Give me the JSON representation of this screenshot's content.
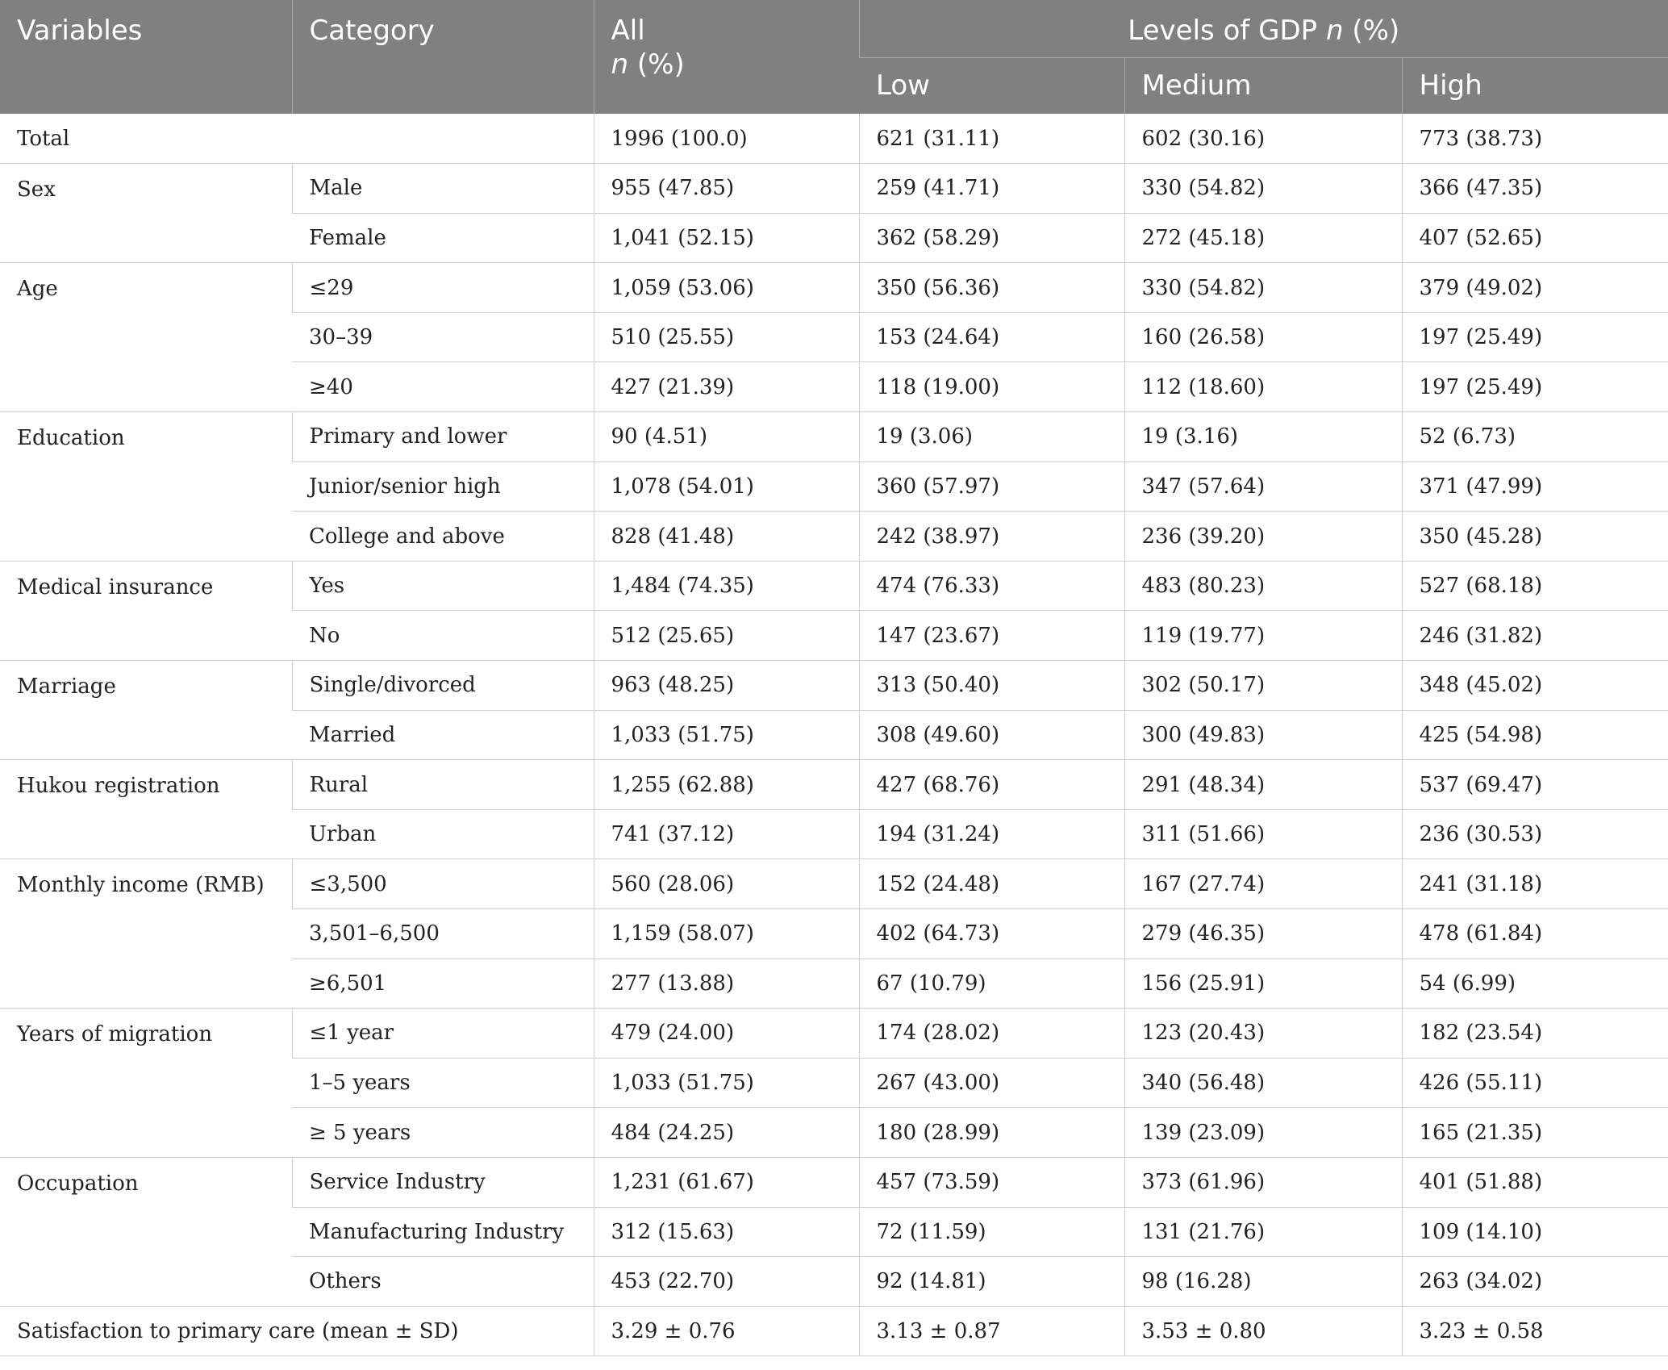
{
  "header": {
    "variables": "Variables",
    "category": "Category",
    "all_line1": "All",
    "all_n": "n",
    "all_pct": " (%)",
    "gdp_prefix": "Levels of GDP ",
    "gdp_n": "n",
    "gdp_pct": " (%)",
    "low": "Low",
    "medium": "Medium",
    "high": "High"
  },
  "total": {
    "label": "Total",
    "all": "1996 (100.0)",
    "low": "621 (31.11)",
    "medium": "602 (30.16)",
    "high": "773 (38.73)"
  },
  "groups": [
    {
      "variable": "Sex",
      "rows": [
        {
          "category": "Male",
          "all": "955 (47.85)",
          "low": "259 (41.71)",
          "medium": "330 (54.82)",
          "high": "366 (47.35)"
        },
        {
          "category": "Female",
          "all": "1,041 (52.15)",
          "low": "362 (58.29)",
          "medium": "272 (45.18)",
          "high": "407 (52.65)"
        }
      ]
    },
    {
      "variable": "Age",
      "rows": [
        {
          "category": "≤29",
          "all": "1,059 (53.06)",
          "low": "350 (56.36)",
          "medium": "330 (54.82)",
          "high": "379 (49.02)"
        },
        {
          "category": "30–39",
          "all": "510 (25.55)",
          "low": "153 (24.64)",
          "medium": "160 (26.58)",
          "high": "197 (25.49)"
        },
        {
          "category": "≥40",
          "all": "427 (21.39)",
          "low": "118 (19.00)",
          "medium": "112 (18.60)",
          "high": "197 (25.49)"
        }
      ]
    },
    {
      "variable": "Education",
      "rows": [
        {
          "category": "Primary and lower",
          "all": "90 (4.51)",
          "low": "19 (3.06)",
          "medium": "19 (3.16)",
          "high": "52 (6.73)"
        },
        {
          "category": "Junior/senior high",
          "all": "1,078 (54.01)",
          "low": "360 (57.97)",
          "medium": "347 (57.64)",
          "high": "371 (47.99)"
        },
        {
          "category": "College and above",
          "all": "828 (41.48)",
          "low": "242 (38.97)",
          "medium": "236 (39.20)",
          "high": "350 (45.28)"
        }
      ]
    },
    {
      "variable": "Medical insurance",
      "rows": [
        {
          "category": "Yes",
          "all": "1,484 (74.35)",
          "low": "474 (76.33)",
          "medium": "483 (80.23)",
          "high": "527 (68.18)"
        },
        {
          "category": "No",
          "all": "512 (25.65)",
          "low": "147 (23.67)",
          "medium": "119 (19.77)",
          "high": "246 (31.82)"
        }
      ]
    },
    {
      "variable": "Marriage",
      "rows": [
        {
          "category": "Single/divorced",
          "all": "963 (48.25)",
          "low": "313 (50.40)",
          "medium": "302 (50.17)",
          "high": "348 (45.02)"
        },
        {
          "category": "Married",
          "all": "1,033 (51.75)",
          "low": "308 (49.60)",
          "medium": "300 (49.83)",
          "high": "425 (54.98)"
        }
      ]
    },
    {
      "variable": "Hukou registration",
      "rows": [
        {
          "category": "Rural",
          "all": "1,255 (62.88)",
          "low": "427 (68.76)",
          "medium": "291 (48.34)",
          "high": "537 (69.47)"
        },
        {
          "category": "Urban",
          "all": "741 (37.12)",
          "low": "194 (31.24)",
          "medium": "311 (51.66)",
          "high": "236 (30.53)"
        }
      ]
    },
    {
      "variable": "Monthly income (RMB)",
      "rows": [
        {
          "category": "≤3,500",
          "all": "560 (28.06)",
          "low": "152 (24.48)",
          "medium": "167 (27.74)",
          "high": "241 (31.18)"
        },
        {
          "category": "3,501–6,500",
          "all": "1,159 (58.07)",
          "low": "402 (64.73)",
          "medium": "279 (46.35)",
          "high": "478 (61.84)"
        },
        {
          "category": "≥6,501",
          "all": "277 (13.88)",
          "low": "67 (10.79)",
          "medium": "156 (25.91)",
          "high": "54 (6.99)"
        }
      ]
    },
    {
      "variable": "Years of migration",
      "rows": [
        {
          "category": "≤1 year",
          "all": "479 (24.00)",
          "low": "174 (28.02)",
          "medium": "123 (20.43)",
          "high": "182 (23.54)"
        },
        {
          "category": "1–5 years",
          "all": "1,033 (51.75)",
          "low": "267 (43.00)",
          "medium": "340 (56.48)",
          "high": "426 (55.11)"
        },
        {
          "category": "≥ 5 years",
          "all": "484 (24.25)",
          "low": "180 (28.99)",
          "medium": "139 (23.09)",
          "high": "165 (21.35)"
        }
      ]
    },
    {
      "variable": "Occupation",
      "rows": [
        {
          "category": "Service Industry",
          "all": "1,231 (61.67)",
          "low": "457 (73.59)",
          "medium": "373 (61.96)",
          "high": "401 (51.88)"
        },
        {
          "category": "Manufacturing Industry",
          "all": "312 (15.63)",
          "low": "72 (11.59)",
          "medium": "131 (21.76)",
          "high": "109 (14.10)"
        },
        {
          "category": "Others",
          "all": "453 (22.70)",
          "low": "92 (14.81)",
          "medium": "98 (16.28)",
          "high": "263 (34.02)"
        }
      ]
    }
  ],
  "satisfaction": {
    "label": "Satisfaction to primary care (mean ± SD)",
    "all": "3.29 ± 0.76",
    "low": "3.13 ± 0.87",
    "medium": "3.53 ± 0.80",
    "high": "3.23 ± 0.58"
  }
}
